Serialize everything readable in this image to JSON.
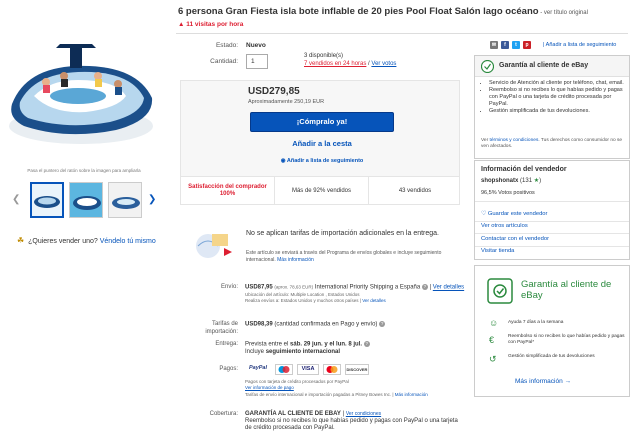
{
  "listing": {
    "title": "6 persona Gran Fiesta isla bote inflable de 20 pies Pool Float Salón lago océano",
    "title_suffix": " - ver título original",
    "hot": "11 visitas por hora"
  },
  "gallery": {
    "hint": "Pasa el puntero del ratón sobre la imagen para ampliarla",
    "sell_question": "¿Quieres vender uno?",
    "sell_link": "Véndelo tú mismo"
  },
  "details": {
    "condition_label": "Estado:",
    "condition_value": "Nuevo",
    "quantity_label": "Cantidad:",
    "quantity_value": "1",
    "available": "3 disponible(s)",
    "sold": "7 vendidos en 24 horas",
    "sold_sep": " / ",
    "see_reviews": "Ver votos"
  },
  "buy": {
    "price": "USD279,85",
    "approx": "Aproximadamente 250,19 EUR",
    "buy_now": "¡Cómpralo ya!",
    "add_cart": "Añadir a la cesta",
    "watch": "Añadir a lista de seguimiento"
  },
  "stats": {
    "satisfaction": "Satisfacción del comprador 100%",
    "percent_sold": "Más de 92% vendidos",
    "sold_count": "43 vendidos"
  },
  "import": {
    "heading": "No se aplican tarifas de importación adicionales en la entrega.",
    "desc": "Este artículo se enviará a través del Programa de envíos globales e incluye seguimiento internacional.",
    "more": "Más información"
  },
  "shipping": {
    "label": "Envío:",
    "amount": "USD87,95",
    "approx": "(aprox. 78,63 EUR)",
    "service": "International Priority Shipping a España",
    "details": "Ver detalles",
    "location": "Ubicación del artículo: Multiple Location , Estados Unidos",
    "ships_to": "Realiza envíos a: Estados Unidos y muchos otros países",
    "ships_more": "Ver detalles"
  },
  "fees": {
    "label": "Tarifas de importación:",
    "amount": "USD98,39",
    "note": "(cantidad confirmada en Pago y envío)"
  },
  "delivery": {
    "label": "Entrega:",
    "text_pre": "Prevista entre el ",
    "date_range": "sáb. 29 jun. y el lun. 8 jul.",
    "text_post": "Incluye ",
    "tracking": "seguimiento internacional"
  },
  "payments": {
    "label": "Pagos:",
    "methods": [
      "PayPal",
      "",
      "VISA",
      "",
      "DISCOVER"
    ],
    "credit": "Pagos con tarjeta de crédito procesados por PayPal",
    "info": "Ver información de pago",
    "import_note": "Tarifas de envío internacional e importación pagadas a Pitney Bowes Inc.",
    "import_more": "Más información"
  },
  "coverage": {
    "label": "Cobertura:",
    "title": "GARANTÍA AL CLIENTE DE EBAY",
    "link": "Ver condiciones",
    "desc": "Reembolso si no recibes lo que habías pedido y pagas con PayPal o una tarjeta de crédito procesada con PayPal."
  },
  "sidebar": {
    "watch_link": "Añadir a lista de seguimiento",
    "guarantee_title": "Garantía al cliente de eBay",
    "guarantee_items": [
      "Servicio de Atención al cliente por teléfono, chat, email.",
      "Reembolso si no recibes lo que habías pedido y pagas con PayPal o una tarjeta de crédito procesada por PayPal.",
      "Gestión simplificada de tus devoluciones."
    ],
    "guarantee_foot_link": "términos y condiciones",
    "guarantee_foot_pre": "Ver ",
    "guarantee_foot_post": ". Tus derechos como consumidor no se ven afectados.",
    "seller_title": "Información del vendedor",
    "seller_name": "shopshonatx",
    "seller_score": "(131",
    "seller_score_end": ")",
    "seller_positive": "96,5% Votos positivos",
    "save_seller": "Guardar este vendedor",
    "other_items": "Ver otros artículos",
    "contact": "Contactar con el vendedor",
    "store": "Visitar tienda"
  },
  "banner": {
    "title": "Garantía al cliente de eBay",
    "rows": [
      "Ayuda 7 días a la semana",
      "Reembolso si no recibes lo que habías pedido y pagas con PayPal*",
      "Gestión simplificada de tus devoluciones"
    ],
    "more": "Más información"
  },
  "colors": {
    "link": "#0654ba",
    "alert": "#dd1e31",
    "green": "#2b8a3e"
  }
}
